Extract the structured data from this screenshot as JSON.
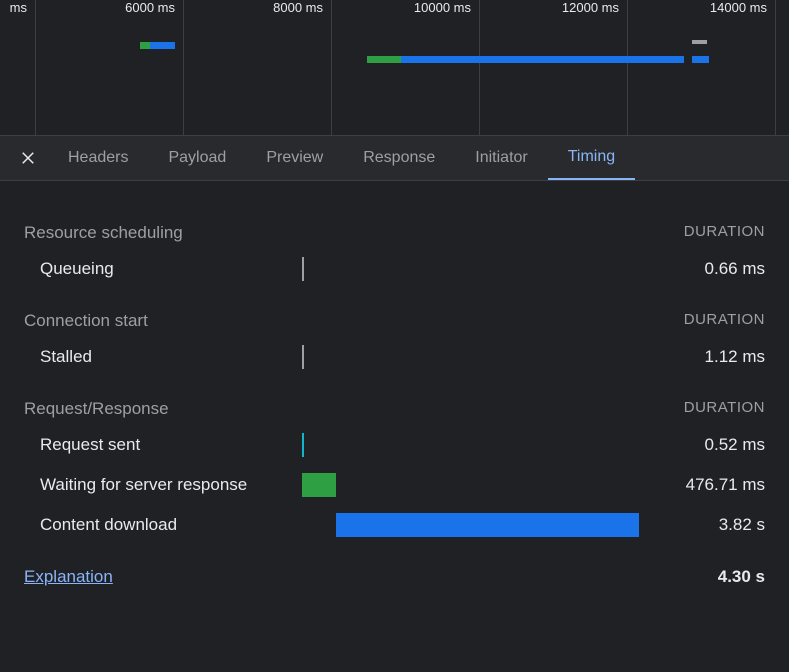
{
  "ruler": {
    "ms_partial": "ms",
    "ticks": [
      "6000 ms",
      "8000 ms",
      "10000 ms",
      "12000 ms",
      "14000 ms"
    ]
  },
  "tabs": {
    "headers": "Headers",
    "payload": "Payload",
    "preview": "Preview",
    "response": "Response",
    "initiator": "Initiator",
    "timing": "Timing"
  },
  "timing": {
    "sections": {
      "scheduling": {
        "title": "Resource scheduling",
        "duration_label": "DURATION"
      },
      "connection": {
        "title": "Connection start",
        "duration_label": "DURATION"
      },
      "request": {
        "title": "Request/Response",
        "duration_label": "DURATION"
      }
    },
    "rows": {
      "queueing": {
        "label": "Queueing",
        "value": "0.66 ms"
      },
      "stalled": {
        "label": "Stalled",
        "value": "1.12 ms"
      },
      "request_sent": {
        "label": "Request sent",
        "value": "0.52 ms"
      },
      "waiting": {
        "label": "Waiting for server response",
        "value": "476.71 ms"
      },
      "download": {
        "label": "Content download",
        "value": "3.82 s"
      }
    },
    "footer": {
      "explanation": "Explanation",
      "total": "4.30 s"
    }
  }
}
